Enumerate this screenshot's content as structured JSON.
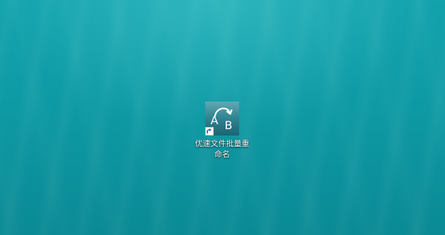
{
  "desktop": {
    "wallpaper_color": "#0e9aa4",
    "icons": [
      {
        "label": "优速文件批量重命名",
        "icon_name": "rename-ab-icon",
        "icon_letters": [
          "A",
          "B"
        ],
        "is_shortcut": true
      }
    ]
  }
}
